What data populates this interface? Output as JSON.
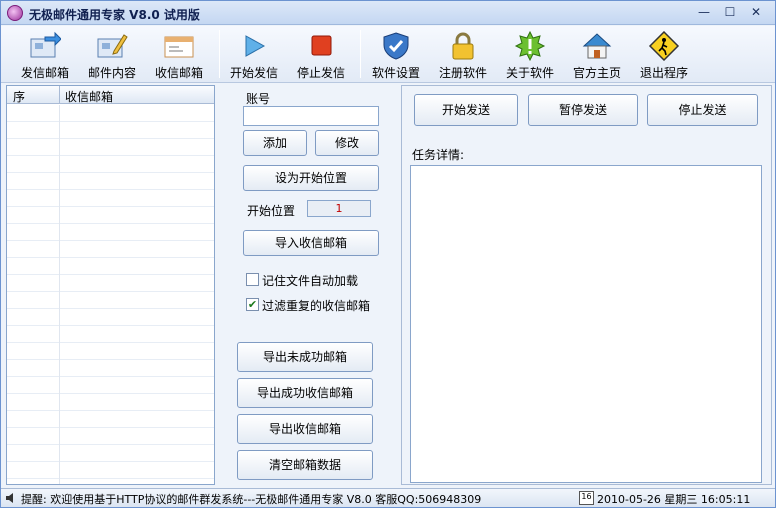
{
  "window": {
    "title": "无极邮件通用专家 V8.0 试用版",
    "controls": {
      "minimize": "—",
      "maximize": "☐",
      "close": "✕"
    }
  },
  "toolbar": {
    "items": [
      {
        "label": "发信邮箱",
        "icon": "sender-mailbox-icon"
      },
      {
        "label": "邮件内容",
        "icon": "mail-content-icon"
      },
      {
        "label": "收信邮箱",
        "icon": "recipient-mailbox-icon"
      },
      {
        "label": "开始发信",
        "icon": "play-icon"
      },
      {
        "label": "停止发信",
        "icon": "stop-icon"
      },
      {
        "label": "软件设置",
        "icon": "shield-icon"
      },
      {
        "label": "注册软件",
        "icon": "lock-icon"
      },
      {
        "label": "关于软件",
        "icon": "info-badge-icon"
      },
      {
        "label": "官方主页",
        "icon": "home-icon"
      },
      {
        "label": "退出程序",
        "icon": "exit-sign-icon"
      }
    ]
  },
  "list": {
    "columns": [
      "序",
      "收信邮箱"
    ],
    "rows": []
  },
  "account": {
    "label": "账号",
    "value": "",
    "add_label": "添加",
    "modify_label": "修改",
    "set_start_label": "设为开始位置",
    "start_pos_label": "开始位置",
    "start_pos_value": "1",
    "import_label": "导入收信邮箱",
    "remember_label": "记住文件自动加载",
    "remember_checked": false,
    "filter_label": "过滤重复的收信邮箱",
    "filter_checked": true,
    "export_failed_label": "导出未成功邮箱",
    "export_success_label": "导出成功收信邮箱",
    "export_all_label": "导出收信邮箱",
    "clear_label": "清空邮箱数据"
  },
  "send": {
    "start_label": "开始发送",
    "pause_label": "暂停发送",
    "stop_label": "停止发送",
    "task_label": "任务详情:",
    "task_text": ""
  },
  "status": {
    "text": "提醒:  欢迎使用基于HTTP协议的邮件群发系统---无极邮件通用专家 V8.0 客服QQ:506948309",
    "calendar_day": "16",
    "datetime": "2010-05-26 星期三 16:05:11"
  },
  "colors": {
    "accent": "#6c93d0",
    "start_pos": "#c00000"
  }
}
